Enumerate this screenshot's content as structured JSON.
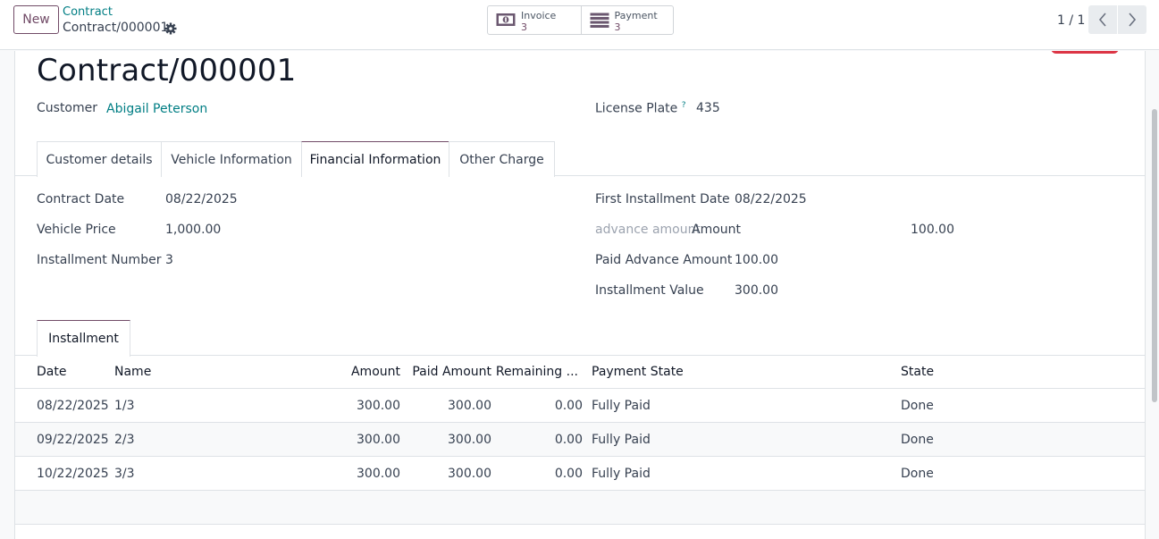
{
  "control_panel": {
    "new_label": "New",
    "breadcrumb_parent": "Contract",
    "breadcrumb_current": "Contract/000001",
    "smart_buttons": [
      {
        "label": "Invoice",
        "count": "3",
        "icon": "invoice-icon"
      },
      {
        "label": "Payment",
        "count": "3",
        "icon": "payment-icon"
      }
    ],
    "pager": "1 / 1"
  },
  "record": {
    "title": "Contract/000001",
    "customer_label": "Customer",
    "customer_value": "Abigail Peterson",
    "license_label": "License Plate",
    "license_help": "?",
    "license_value": "435"
  },
  "tabs": [
    "Customer details",
    "Vehicle Information",
    "Financial Information",
    "Other Charge"
  ],
  "financial": {
    "contract_date_label": "Contract Date",
    "contract_date": "08/22/2025",
    "vehicle_price_label": "Vehicle Price",
    "vehicle_price": "1,000.00",
    "installment_number_label": "Installment Number",
    "installment_number": "3",
    "first_installment_label": "First Installment Date",
    "first_installment": "08/22/2025",
    "advance_label": "advance amount",
    "advance_sub_label": "Amount",
    "advance_value": "100.00",
    "paid_advance_label": "Paid Advance Amount",
    "paid_advance": "100.00",
    "installment_value_label": "Installment Value",
    "installment_value": "300.00"
  },
  "subtab": "Installment",
  "table": {
    "columns": [
      "Date",
      "Name",
      "Amount",
      "Paid Amount",
      "Remaining ...",
      "Payment State",
      "State"
    ],
    "rows": [
      [
        "08/22/2025",
        "1/3",
        "300.00",
        "300.00",
        "0.00",
        "Fully Paid",
        "Done"
      ],
      [
        "09/22/2025",
        "2/3",
        "300.00",
        "300.00",
        "0.00",
        "Fully Paid",
        "Done"
      ],
      [
        "10/22/2025",
        "3/3",
        "300.00",
        "300.00",
        "0.00",
        "Fully Paid",
        "Done"
      ]
    ]
  },
  "colors": {
    "brand": "#714B67",
    "link": "#017e84",
    "danger": "#dc3545"
  }
}
